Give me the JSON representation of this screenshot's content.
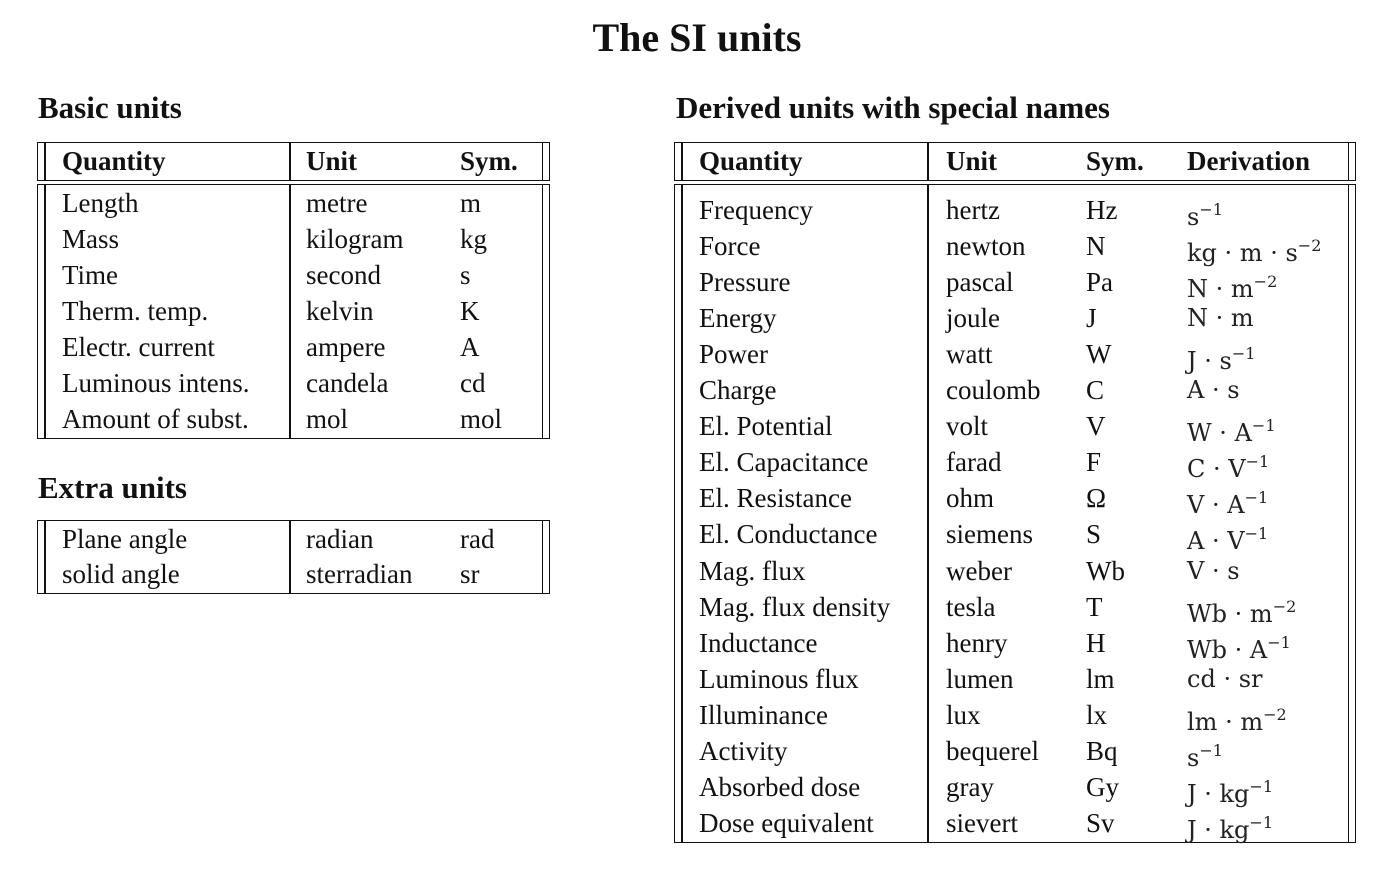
{
  "title": "The SI units",
  "basic": {
    "heading": "Basic units",
    "columns": [
      "Quantity",
      "Unit",
      "Sym."
    ],
    "rows": [
      [
        "Length",
        "metre",
        "m"
      ],
      [
        "Mass",
        "kilogram",
        "kg"
      ],
      [
        "Time",
        "second",
        "s"
      ],
      [
        "Therm. temp.",
        "kelvin",
        "K"
      ],
      [
        "Electr. current",
        "ampere",
        "A"
      ],
      [
        "Luminous intens.",
        "candela",
        "cd"
      ],
      [
        "Amount of subst.",
        "mol",
        "mol"
      ]
    ]
  },
  "extra": {
    "heading": "Extra units",
    "rows": [
      [
        "Plane angle",
        "radian",
        "rad"
      ],
      [
        "solid angle",
        "sterradian",
        "sr"
      ]
    ]
  },
  "derived": {
    "heading": "Derived units with special names",
    "columns": [
      "Quantity",
      "Unit",
      "Sym.",
      "Derivation"
    ],
    "rows": [
      {
        "q": "Frequency",
        "u": "hertz",
        "s": "Hz",
        "d": [
          [
            "s",
            "−1"
          ]
        ]
      },
      {
        "q": "Force",
        "u": "newton",
        "s": "N",
        "d": [
          [
            "kg",
            ""
          ],
          [
            "m",
            ""
          ],
          [
            "s",
            "−2"
          ]
        ]
      },
      {
        "q": "Pressure",
        "u": "pascal",
        "s": "Pa",
        "d": [
          [
            "N",
            ""
          ],
          [
            "m",
            "−2"
          ]
        ]
      },
      {
        "q": "Energy",
        "u": "joule",
        "s": "J",
        "d": [
          [
            "N",
            ""
          ],
          [
            "m",
            ""
          ]
        ]
      },
      {
        "q": "Power",
        "u": "watt",
        "s": "W",
        "d": [
          [
            "J",
            ""
          ],
          [
            "s",
            "−1"
          ]
        ]
      },
      {
        "q": "Charge",
        "u": "coulomb",
        "s": "C",
        "d": [
          [
            "A",
            ""
          ],
          [
            "s",
            ""
          ]
        ]
      },
      {
        "q": "El. Potential",
        "u": "volt",
        "s": "V",
        "d": [
          [
            "W",
            ""
          ],
          [
            "A",
            "−1"
          ]
        ]
      },
      {
        "q": "El. Capacitance",
        "u": "farad",
        "s": "F",
        "d": [
          [
            "C",
            ""
          ],
          [
            "V",
            "−1"
          ]
        ]
      },
      {
        "q": "El. Resistance",
        "u": "ohm",
        "s": "Ω",
        "d": [
          [
            "V",
            ""
          ],
          [
            "A",
            "−1"
          ]
        ]
      },
      {
        "q": "El. Conductance",
        "u": "siemens",
        "s": "S",
        "d": [
          [
            "A",
            ""
          ],
          [
            "V",
            "−1"
          ]
        ]
      },
      {
        "q": "Mag. flux",
        "u": "weber",
        "s": "Wb",
        "d": [
          [
            "V",
            ""
          ],
          [
            "s",
            ""
          ]
        ]
      },
      {
        "q": "Mag. flux density",
        "u": "tesla",
        "s": "T",
        "d": [
          [
            "Wb",
            ""
          ],
          [
            "m",
            "−2"
          ]
        ]
      },
      {
        "q": "Inductance",
        "u": "henry",
        "s": "H",
        "d": [
          [
            "Wb",
            ""
          ],
          [
            "A",
            "−1"
          ]
        ]
      },
      {
        "q": "Luminous flux",
        "u": "lumen",
        "s": "lm",
        "d": [
          [
            "cd",
            ""
          ],
          [
            "sr",
            ""
          ]
        ]
      },
      {
        "q": "Illuminance",
        "u": "lux",
        "s": "lx",
        "d": [
          [
            "lm",
            ""
          ],
          [
            "m",
            "−2"
          ]
        ]
      },
      {
        "q": "Activity",
        "u": "bequerel",
        "s": "Bq",
        "d": [
          [
            "s",
            "−1"
          ]
        ]
      },
      {
        "q": "Absorbed dose",
        "u": "gray",
        "s": "Gy",
        "d": [
          [
            "J",
            ""
          ],
          [
            "kg",
            "−1"
          ]
        ]
      },
      {
        "q": "Dose equivalent",
        "u": "sievert",
        "s": "Sv",
        "d": [
          [
            "J",
            ""
          ],
          [
            "kg",
            "−1"
          ]
        ]
      }
    ]
  }
}
